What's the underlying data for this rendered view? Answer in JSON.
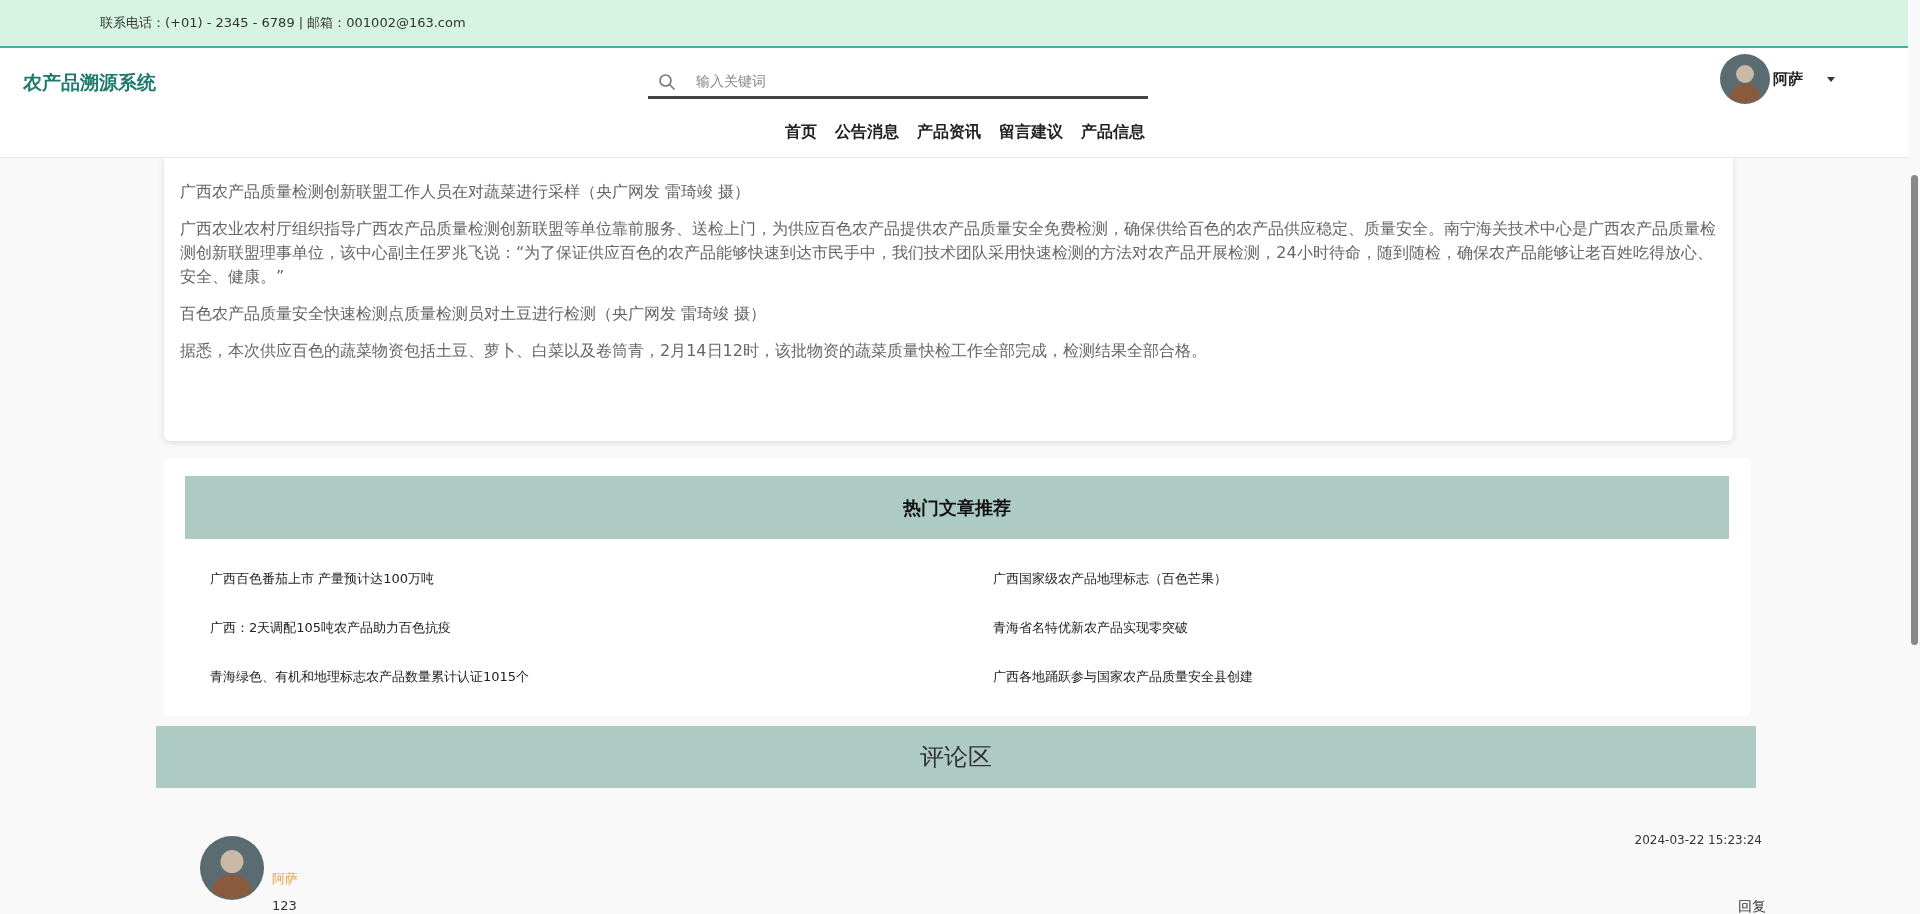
{
  "contact_bar": {
    "text": "联系电话：(+01) - 2345 - 6789 | 邮箱：001002@163.com"
  },
  "header": {
    "logo": "农产品溯源系统",
    "search": {
      "placeholder": "输入关键词"
    },
    "user": {
      "name": "阿萨"
    },
    "nav": [
      "首页",
      "公告消息",
      "产品资讯",
      "留言建议",
      "产品信息"
    ]
  },
  "article": {
    "paragraphs": [
      "广西农产品质量检测创新联盟工作人员在对蔬菜进行采样（央广网发 雷琦竣 摄）",
      "广西农业农村厅组织指导广西农产品质量检测创新联盟等单位靠前服务、送检上门，为供应百色农产品提供农产品质量安全免费检测，确保供给百色的农产品供应稳定、质量安全。南宁海关技术中心是广西农产品质量检测创新联盟理事单位，该中心副主任罗兆飞说：“为了保证供应百色的农产品能够快速到达市民手中，我们技术团队采用快速检测的方法对农产品开展检测，24小时待命，随到随检，确保农产品能够让老百姓吃得放心、安全、健康。”",
      "百色农产品质量安全快速检测点质量检测员对土豆进行检测（央广网发 雷琦竣 摄）",
      "据悉，本次供应百色的蔬菜物资包括土豆、萝卜、白菜以及卷筒青，2月14日12时，该批物资的蔬菜质量快检工作全部完成，检测结果全部合格。"
    ]
  },
  "hot_articles": {
    "title": "热门文章推荐",
    "items": [
      "广西百色番茄上市 产量预计达100万吨",
      "广西国家级农产品地理标志（百色芒果）",
      "广西：2天调配105吨农产品助力百色抗疫",
      "青海省名特优新农产品实现零突破",
      "青海绿色、有机和地理标志农产品数量累计认证1015个",
      "广西各地踊跃参与国家农产品质量安全县创建"
    ]
  },
  "comments": {
    "title": "评论区",
    "items": [
      {
        "user": "阿萨",
        "time": "2024-03-22 15:23:24",
        "content": "123",
        "reply": "回复"
      }
    ]
  }
}
